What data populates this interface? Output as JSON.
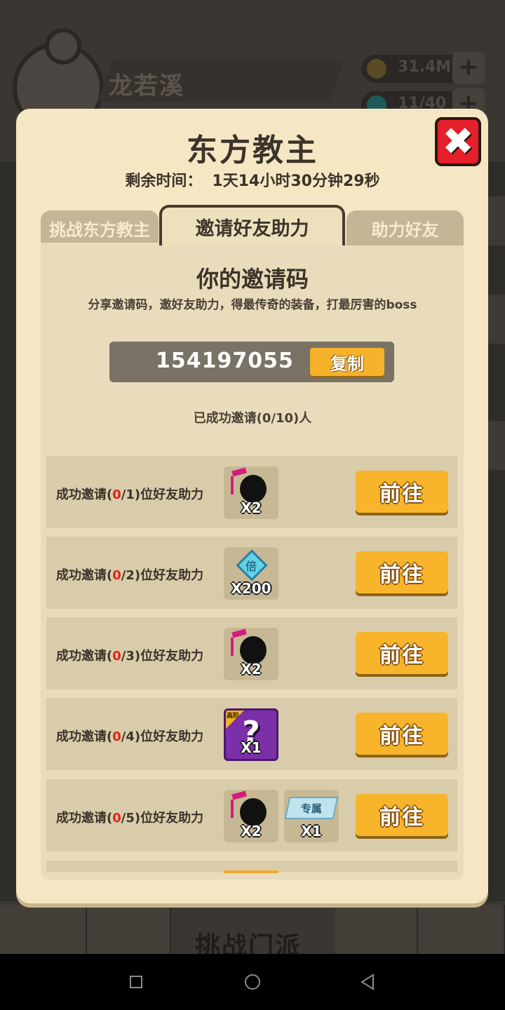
{
  "background": {
    "player_name": "龙若溪",
    "resource_1": "31.4M",
    "resource_2": "11/40",
    "plus_icon": "+",
    "challenge_sect": "挑战门派"
  },
  "modal": {
    "title": "东方教主",
    "timer_label": "剩余时间：",
    "timer_value": "1天14小时30分钟29秒",
    "close_icon": "✖",
    "tabs": [
      {
        "label": "挑战东方教主",
        "active": false
      },
      {
        "label": "邀请好友助力",
        "active": true
      },
      {
        "label": "助力好友",
        "active": false
      }
    ],
    "invite": {
      "title": "你的邀请码",
      "description": "分享邀请码，邀好友助力，得最传奇的装备，打最厉害的boss",
      "code": "154197055",
      "copy_label": "复制",
      "invited_status": "已成功邀请(0/10)人"
    },
    "rewards": [
      {
        "prefix": "成功邀请(",
        "current": "0",
        "suffix": "/1)位好友助力",
        "items": [
          {
            "icon": "ninja-icon",
            "qty": "X2"
          }
        ],
        "button": "前往"
      },
      {
        "prefix": "成功邀请(",
        "current": "0",
        "suffix": "/2)位好友助力",
        "items": [
          {
            "icon": "multiplier-gem-icon",
            "glyph": "倍",
            "qty": "X200"
          }
        ],
        "button": "前往"
      },
      {
        "prefix": "成功邀请(",
        "current": "0",
        "suffix": "/3)位好友助力",
        "items": [
          {
            "icon": "ninja-icon",
            "qty": "X2"
          }
        ],
        "button": "前往"
      },
      {
        "prefix": "成功邀请(",
        "current": "0",
        "suffix": "/4)位好友助力",
        "items": [
          {
            "icon": "mystery-box-icon",
            "tag": "高阶",
            "qty": "X1"
          }
        ],
        "button": "前往"
      },
      {
        "prefix": "成功邀请(",
        "current": "0",
        "suffix": "/5)位好友助力",
        "items": [
          {
            "icon": "ninja-icon",
            "qty": "X2"
          },
          {
            "icon": "exclusive-badge-icon",
            "tag": "专属",
            "qty": "X1"
          }
        ],
        "button": "前往"
      }
    ]
  },
  "colors": {
    "modal_bg": "#f6e7c4",
    "button_orange": "#f8b42a",
    "close_red": "#e5202a",
    "highlight_red": "#e3211b"
  }
}
